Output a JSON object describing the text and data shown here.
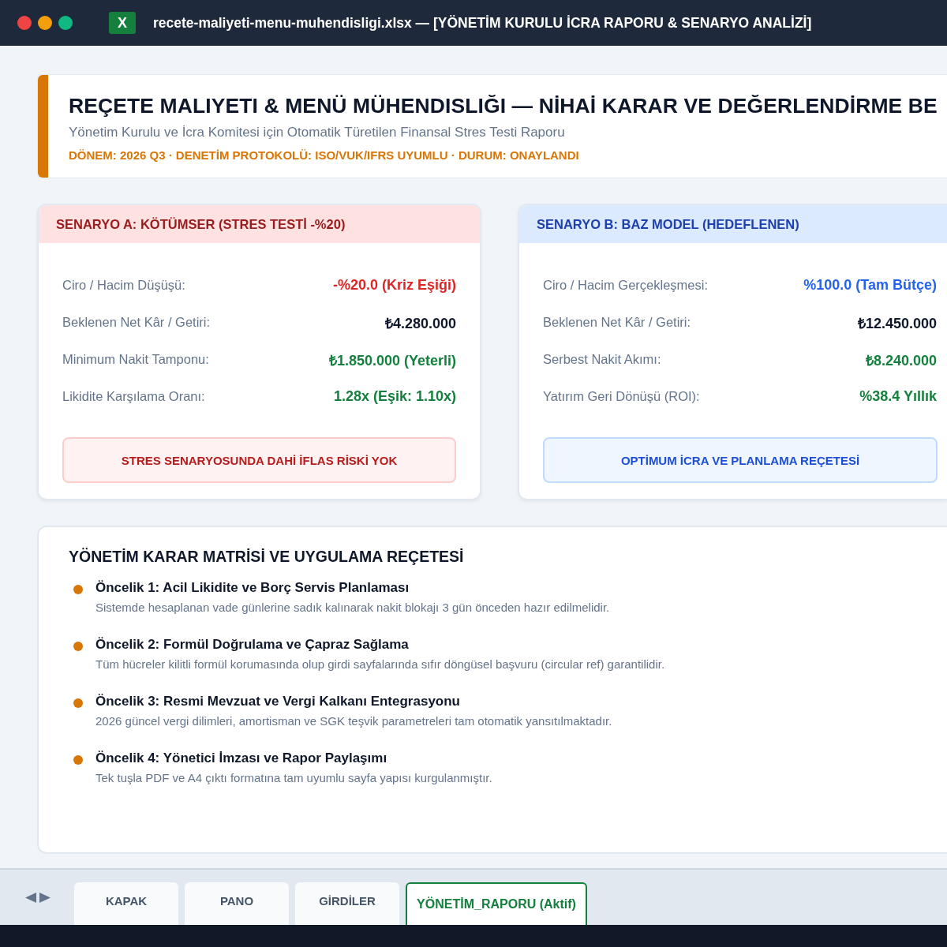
{
  "window": {
    "title": "recete-maliyeti-menu-muhendisligi.xlsx — [YÖNETİM KURULU İCRA RAPORU & SENARYO ANALİZİ]",
    "app_icon": "X"
  },
  "header": {
    "title": "REÇETE MALIYETI & MENÜ MÜHENDISLIĞI — NİHAİ KARAR VE DEĞERLENDİRME BE",
    "subtitle": "Yönetim Kurulu ve İcra Komitesi için Otomatik Türetilen Finansal Stres Testi Raporu",
    "meta": "DÖNEM: 2026 Q3 · DENETİM PROTOKOLÜ: ISO/VUK/IFRS UYUMLU · DURUM: ONAYLANDI"
  },
  "scenarios": [
    {
      "kind": "risk",
      "title": "SENARYO A: KÖTÜMSER (STRES TESTİ -%20)",
      "rows": [
        {
          "label": "Ciro / Hacim Düşüşü:",
          "value": "-%20.0 (Kriz Eşiği)",
          "color": "#dc2626"
        },
        {
          "label": "Beklenen Net Kâr / Getiri:",
          "value": "₺4.280.000",
          "color": "#0f172a"
        },
        {
          "label": "Minimum Nakit Tamponu:",
          "value": "₺1.850.000 (Yeterli)",
          "color": "#15803d"
        },
        {
          "label": "Likidite Karşılama Oranı:",
          "value": "1.28x (Eşik: 1.10x)",
          "color": "#15803d"
        }
      ],
      "banner": "STRES SENARYOSUNDA DAHİ İFLAS RİSKİ YOK"
    },
    {
      "kind": "base",
      "title": "SENARYO B: BAZ MODEL (HEDEFLENEN)",
      "rows": [
        {
          "label": "Ciro / Hacim Gerçekleşmesi:",
          "value": "%100.0 (Tam Bütçe)",
          "color": "#2563eb"
        },
        {
          "label": "Beklenen Net Kâr / Getiri:",
          "value": "₺12.450.000",
          "color": "#0f172a"
        },
        {
          "label": "Serbest Nakit Akımı:",
          "value": "₺8.240.000",
          "color": "#15803d"
        },
        {
          "label": "Yatırım Geri Dönüşü (ROI):",
          "value": "%38.4 Yıllık",
          "color": "#15803d"
        }
      ],
      "banner": "OPTİMUM İCRA VE PLANLAMA REÇETESİ"
    }
  ],
  "matrix": {
    "title": "YÖNETİM KARAR MATRİSİ VE UYGULAMA REÇETESİ",
    "items": [
      {
        "title": "Öncelik 1: Acil Likidite ve Borç Servis Planlaması",
        "text": "Sistemde hesaplanan vade günlerine sadık kalınarak nakit blokajı 3 gün önceden hazır edilmelidir."
      },
      {
        "title": "Öncelik 2: Formül Doğrulama ve Çapraz Sağlama",
        "text": "Tüm hücreler kilitli formül korumasında olup girdi sayfalarında sıfır döngüsel başvuru (circular ref) garantilidir."
      },
      {
        "title": "Öncelik 3: Resmi Mevzuat ve Vergi Kalkanı Entegrasyonu",
        "text": "2026 güncel vergi dilimleri, amortisman ve SGK teşvik parametreleri tam otomatik yansıtılmaktadır."
      },
      {
        "title": "Öncelik 4: Yönetici İmzası ve Rapor Paylaşımı",
        "text": "Tek tuşla PDF ve A4 çıktı formatına tam uyumlu sayfa yapısı kurgulanmıştır."
      }
    ]
  },
  "sheet_tabs": [
    {
      "label": "KAPAK",
      "selected": false
    },
    {
      "label": "PANO",
      "selected": false
    },
    {
      "label": "GİRDİLER",
      "selected": false
    },
    {
      "label": "YÖNETİM_RAPORU (Aktif)",
      "selected": true
    }
  ]
}
